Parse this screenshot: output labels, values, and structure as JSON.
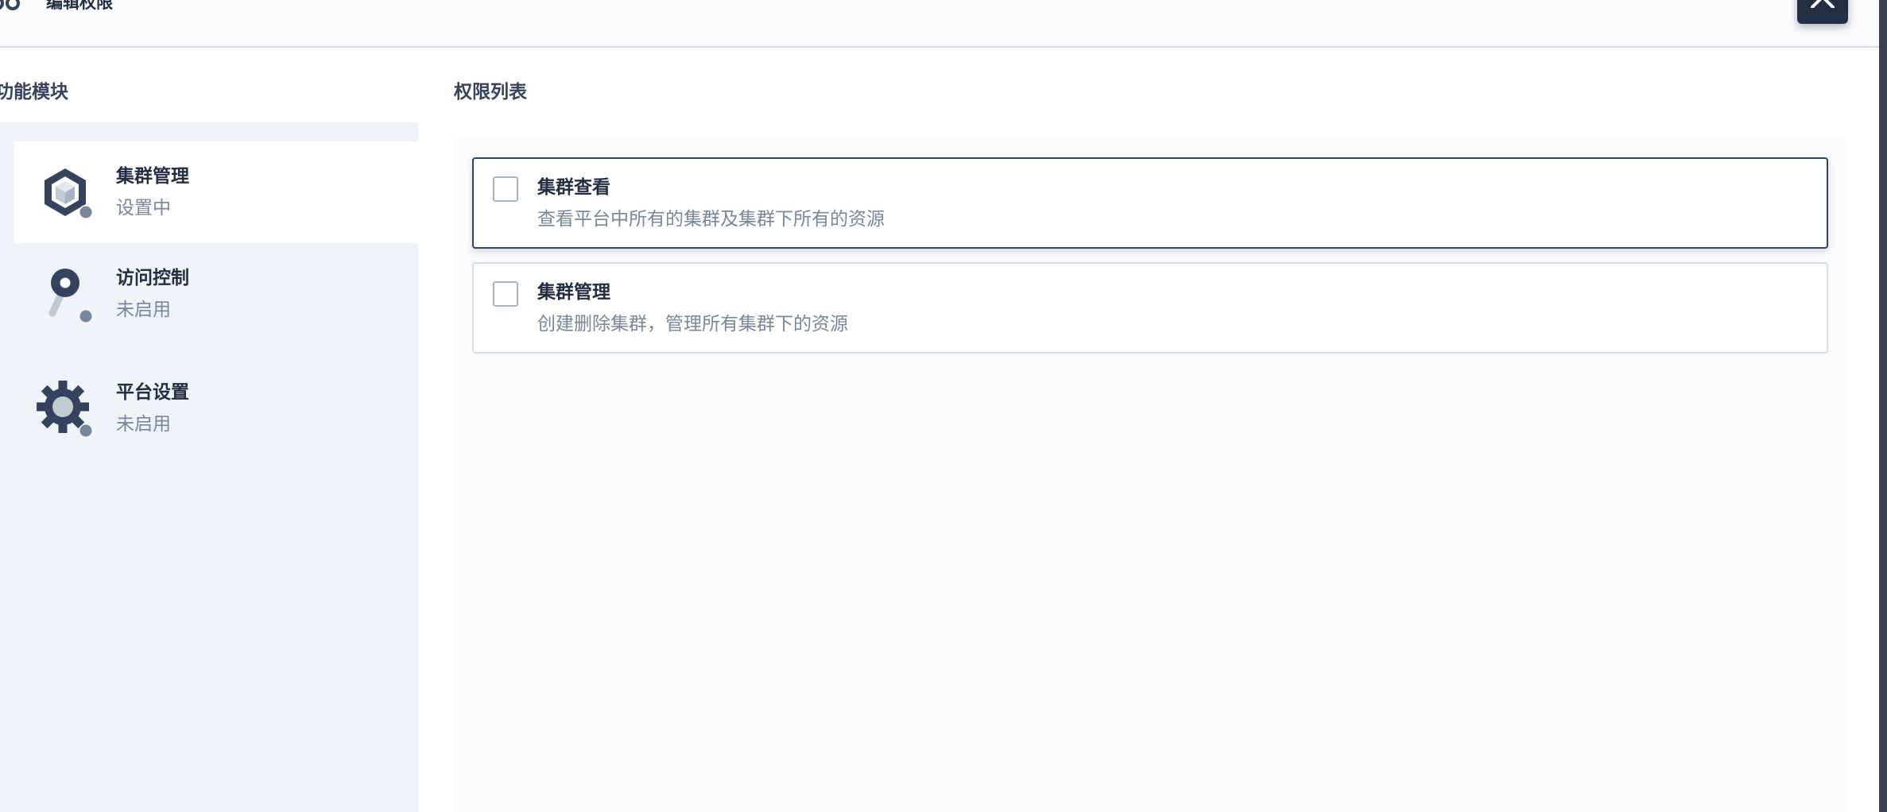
{
  "header": {
    "title": "编辑权限",
    "close_icon": "close-icon",
    "header_icon": "roles-icon"
  },
  "modules": {
    "title": "功能模块",
    "items": [
      {
        "name": "集群管理",
        "status": "设置中",
        "icon": "cluster-icon",
        "active": true
      },
      {
        "name": "访问控制",
        "status": "未启用",
        "icon": "key-icon",
        "active": false
      },
      {
        "name": "平台设置",
        "status": "未启用",
        "icon": "gear-icon",
        "active": false
      }
    ]
  },
  "permissions": {
    "title": "权限列表",
    "items": [
      {
        "name": "集群查看",
        "description": "查看平台中所有的集群及集群下所有的资源",
        "checked": false
      },
      {
        "name": "集群管理",
        "description": "创建删除集群，管理所有集群下的资源",
        "checked": false
      }
    ]
  },
  "colors": {
    "primary_dark": "#242e42",
    "muted_text": "#79879c",
    "panel_bg": "#eff4f9",
    "list_bg": "#f9fbfd",
    "border": "#d8dee5"
  }
}
